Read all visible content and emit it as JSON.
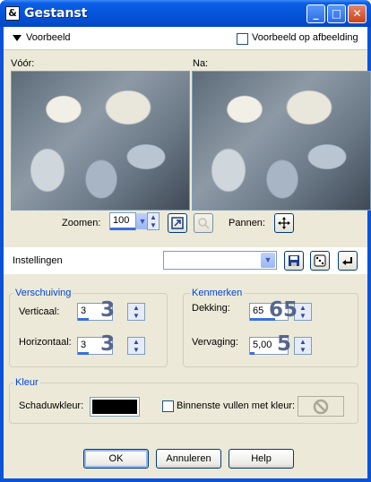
{
  "window": {
    "title": "Gestanst",
    "icon_text": "&",
    "minimize_glyph": "_",
    "maximize_glyph": "□",
    "close_glyph": "✕"
  },
  "top": {
    "section_toggle": "Voorbeeld",
    "preview_on_image_label": "Voorbeeld op afbeelding",
    "preview_on_image_checked": false
  },
  "preview": {
    "before_label": "Vóór:",
    "after_label": "Na:",
    "zoom_label": "Zoomen:",
    "zoom_value": "100",
    "pan_label": "Pannen:"
  },
  "settings": {
    "label": "Instellingen",
    "preset_value": ""
  },
  "offset": {
    "title": "Verschuiving",
    "vertical_label": "Verticaal:",
    "vertical_value": "3",
    "vertical_annotation": "3",
    "horizontal_label": "Horizontaal:",
    "horizontal_value": "3",
    "horizontal_annotation": "3"
  },
  "properties": {
    "title": "Kenmerken",
    "opacity_label": "Dekking:",
    "opacity_value": "65",
    "opacity_annotation": "65",
    "blur_label": "Vervaging:",
    "blur_value": "5,00",
    "blur_annotation": "5"
  },
  "color": {
    "title": "Kleur",
    "shadow_color_label": "Schaduwkleur:",
    "shadow_color": "#000000",
    "fill_inside_label": "Binnenste vullen met kleur:",
    "fill_inside_checked": false
  },
  "buttons": {
    "ok": "OK",
    "cancel": "Annuleren",
    "help": "Help"
  }
}
